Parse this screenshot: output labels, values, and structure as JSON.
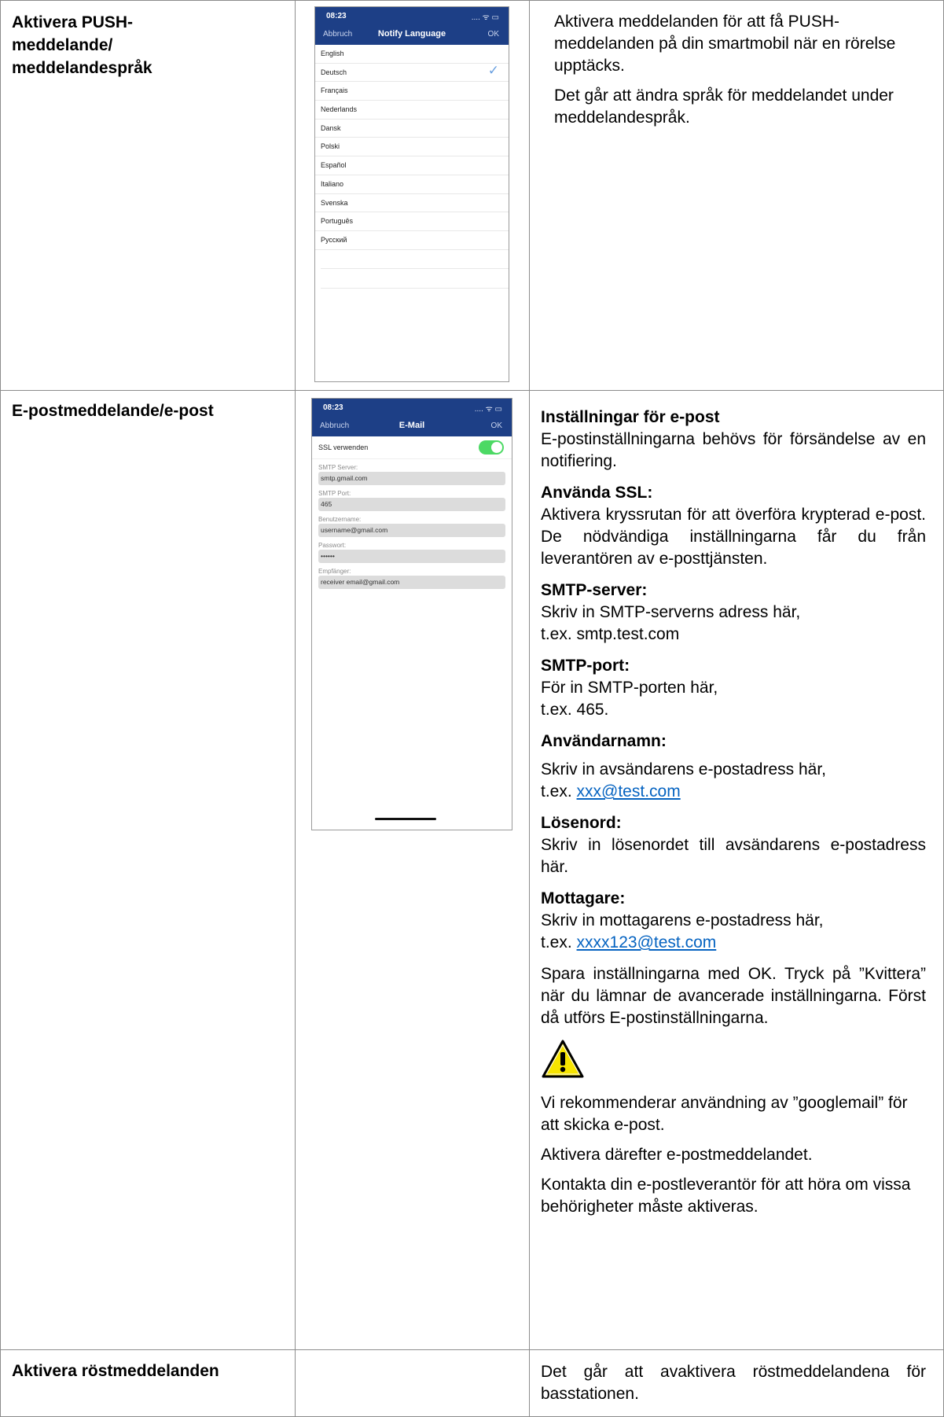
{
  "rows": [
    {
      "title": "Aktivera PUSH-\nmeddelande/\nmeddelandespråk",
      "paragraphs": [
        "Aktivera meddelanden för att få PUSH-meddelanden på din smartmobil när en rörelse upptäcks.",
        "Det går att ändra språk för meddelandet under meddelandespråk."
      ]
    },
    {
      "title": "E-postmeddelande/e-post",
      "blocks": [
        {
          "heading": "Inställningar för e-post",
          "text": "E-postinställningarna behövs för försändelse av en notifiering."
        },
        {
          "heading": "Använda SSL:",
          "text": "Aktivera kryssrutan för att överföra krypterad e-post. De nödvändiga inställningarna får du från leverantören av e-posttjänsten."
        },
        {
          "heading": "SMTP-server:",
          "text": "Skriv in SMTP-serverns adress här,",
          "text2": "t.ex. smtp.test.com"
        },
        {
          "heading": "SMTP-port:",
          "text": "För in SMTP-porten här,",
          "text2": "t.ex. 465."
        },
        {
          "heading": "Användarnamn:",
          "text": "Skriv in avsändarens e-postadress här,",
          "text2_prefix": "t.ex. ",
          "link": "xxx@test.com"
        },
        {
          "heading": "Lösenord:",
          "text": "Skriv in lösenordet till avsändarens e-postadress här."
        },
        {
          "heading": "Mottagare:",
          "text": "Skriv in mottagarens e-postadress här,",
          "text2_prefix": "t.ex. ",
          "link": "xxxx123@test.com"
        }
      ],
      "save_text": "Spara inställningarna med OK. Tryck på ”Kvittera” när du lämnar de avancerade inställningarna. Först då utförs E-postinställningarna.",
      "notes": [
        "Vi rekommenderar användning av ”googlemail” för att skicka e-post.",
        "Aktivera därefter e-postmeddelandet.",
        "Kontakta din e-postleverantör för att höra om vissa behörigheter måste aktiveras."
      ]
    },
    {
      "title": "Aktivera röstmeddelanden",
      "text": "Det går att avaktivera röstmeddelandena för basstationen."
    }
  ],
  "phone1": {
    "time": "08:23",
    "status_icons": "....  ᯤ ▭",
    "nav_left": "Abbruch",
    "nav_title": "Notify Language",
    "nav_right": "OK",
    "languages": [
      "English",
      "Deutsch",
      "Français",
      "Nederlands",
      "Dansk",
      "Polski",
      "Español",
      "Italiano",
      "Svenska",
      "Português",
      "Русский"
    ],
    "selected": "Deutsch",
    "check_icon": "✓"
  },
  "phone2": {
    "time": "08:23",
    "status_icons": "....  ᯤ ▭",
    "nav_left": "Abbruch",
    "nav_title": "E-Mail",
    "nav_right": "OK",
    "ssl_label": "SSL verwenden",
    "ssl_on": true,
    "fields": [
      {
        "label": "SMTP Server:",
        "value": "smtp.gmail.com"
      },
      {
        "label": "SMTP Port:",
        "value": "465"
      },
      {
        "label": "Benutzername:",
        "value": "username@gmail.com"
      },
      {
        "label": "Passwort:",
        "value": "••••••"
      },
      {
        "label": "Empfänger:",
        "value": "receiver email@gmail.com"
      }
    ]
  },
  "colors": {
    "nav_blue": "#1d3f86",
    "toggle_green": "#4cd964",
    "link": "#0563c1",
    "border": "#8c8c8c"
  },
  "warning_icon": "warning-triangle-icon"
}
